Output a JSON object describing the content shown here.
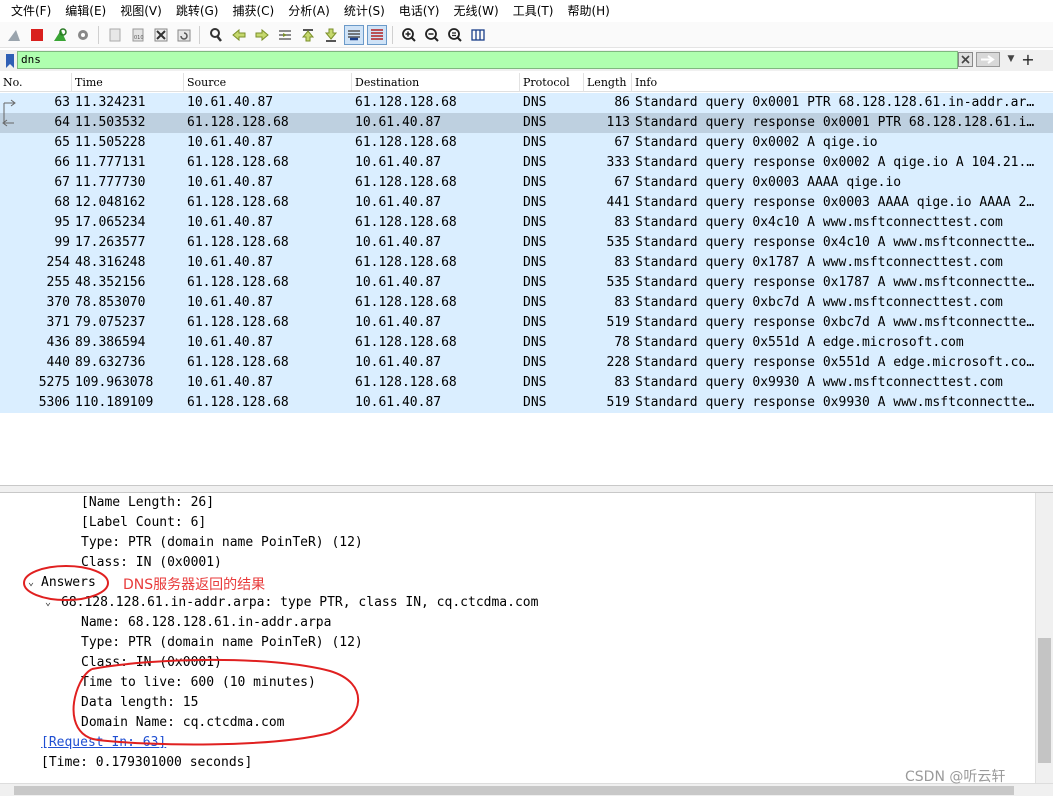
{
  "menu": [
    "文件(F)",
    "编辑(E)",
    "视图(V)",
    "跳转(G)",
    "捕获(C)",
    "分析(A)",
    "统计(S)",
    "电话(Y)",
    "无线(W)",
    "工具(T)",
    "帮助(H)"
  ],
  "filter": {
    "value": "dns"
  },
  "columns": [
    "No.",
    "Time",
    "Source",
    "Destination",
    "Protocol",
    "Length",
    "Info"
  ],
  "packets": [
    {
      "no": "63",
      "time": "11.324231",
      "src": "10.61.40.87",
      "dst": "61.128.128.68",
      "proto": "DNS",
      "len": "86",
      "info": "Standard query 0x0001 PTR 68.128.128.61.in-addr.ar…"
    },
    {
      "no": "64",
      "time": "11.503532",
      "src": "61.128.128.68",
      "dst": "10.61.40.87",
      "proto": "DNS",
      "len": "113",
      "info": "Standard query response 0x0001 PTR 68.128.128.61.i…"
    },
    {
      "no": "65",
      "time": "11.505228",
      "src": "10.61.40.87",
      "dst": "61.128.128.68",
      "proto": "DNS",
      "len": "67",
      "info": "Standard query 0x0002 A qige.io"
    },
    {
      "no": "66",
      "time": "11.777131",
      "src": "61.128.128.68",
      "dst": "10.61.40.87",
      "proto": "DNS",
      "len": "333",
      "info": "Standard query response 0x0002 A qige.io A 104.21.…"
    },
    {
      "no": "67",
      "time": "11.777730",
      "src": "10.61.40.87",
      "dst": "61.128.128.68",
      "proto": "DNS",
      "len": "67",
      "info": "Standard query 0x0003 AAAA qige.io"
    },
    {
      "no": "68",
      "time": "12.048162",
      "src": "61.128.128.68",
      "dst": "10.61.40.87",
      "proto": "DNS",
      "len": "441",
      "info": "Standard query response 0x0003 AAAA qige.io AAAA 2…"
    },
    {
      "no": "95",
      "time": "17.065234",
      "src": "10.61.40.87",
      "dst": "61.128.128.68",
      "proto": "DNS",
      "len": "83",
      "info": "Standard query 0x4c10 A www.msftconnecttest.com"
    },
    {
      "no": "99",
      "time": "17.263577",
      "src": "61.128.128.68",
      "dst": "10.61.40.87",
      "proto": "DNS",
      "len": "535",
      "info": "Standard query response 0x4c10 A www.msftconnectte…"
    },
    {
      "no": "254",
      "time": "48.316248",
      "src": "10.61.40.87",
      "dst": "61.128.128.68",
      "proto": "DNS",
      "len": "83",
      "info": "Standard query 0x1787 A www.msftconnecttest.com"
    },
    {
      "no": "255",
      "time": "48.352156",
      "src": "61.128.128.68",
      "dst": "10.61.40.87",
      "proto": "DNS",
      "len": "535",
      "info": "Standard query response 0x1787 A www.msftconnectte…"
    },
    {
      "no": "370",
      "time": "78.853070",
      "src": "10.61.40.87",
      "dst": "61.128.128.68",
      "proto": "DNS",
      "len": "83",
      "info": "Standard query 0xbc7d A www.msftconnecttest.com"
    },
    {
      "no": "371",
      "time": "79.075237",
      "src": "61.128.128.68",
      "dst": "10.61.40.87",
      "proto": "DNS",
      "len": "519",
      "info": "Standard query response 0xbc7d A www.msftconnectte…"
    },
    {
      "no": "436",
      "time": "89.386594",
      "src": "10.61.40.87",
      "dst": "61.128.128.68",
      "proto": "DNS",
      "len": "78",
      "info": "Standard query 0x551d A edge.microsoft.com"
    },
    {
      "no": "440",
      "time": "89.632736",
      "src": "61.128.128.68",
      "dst": "10.61.40.87",
      "proto": "DNS",
      "len": "228",
      "info": "Standard query response 0x551d A edge.microsoft.co…"
    },
    {
      "no": "5275",
      "time": "109.963078",
      "src": "10.61.40.87",
      "dst": "61.128.128.68",
      "proto": "DNS",
      "len": "83",
      "info": "Standard query 0x9930 A www.msftconnecttest.com"
    },
    {
      "no": "5306",
      "time": "110.189109",
      "src": "61.128.128.68",
      "dst": "10.61.40.87",
      "proto": "DNS",
      "len": "519",
      "info": "Standard query response 0x9930 A www.msftconnectte…"
    }
  ],
  "details": {
    "name_length": "[Name Length: 26]",
    "label_count": "[Label Count: 6]",
    "type_q": "Type: PTR (domain name PoinTeR) (12)",
    "class_q": "Class: IN (0x0001)",
    "answers": "Answers",
    "answer_record": "68.128.128.61.in-addr.arpa: type PTR, class IN, cq.ctcdma.com",
    "name": "Name: 68.128.128.61.in-addr.arpa",
    "type_a": "Type: PTR (domain name PoinTeR) (12)",
    "class_a": "Class: IN (0x0001)",
    "ttl": "Time to live: 600 (10 minutes)",
    "data_length": "Data length: 15",
    "domain_name": "Domain Name: cq.ctcdma.com",
    "request_in": "[Request In: 63]",
    "time": "[Time: 0.179301000 seconds]"
  },
  "annotation": "DNS服务器返回的结果",
  "watermark": "CSDN @听云轩",
  "colors": {
    "row_bg": "#daeeff",
    "row_selected": "#bed0e0",
    "filter_ok": "#afffaf",
    "annotation_red": "#e83a3a"
  },
  "selected_packet": "64"
}
